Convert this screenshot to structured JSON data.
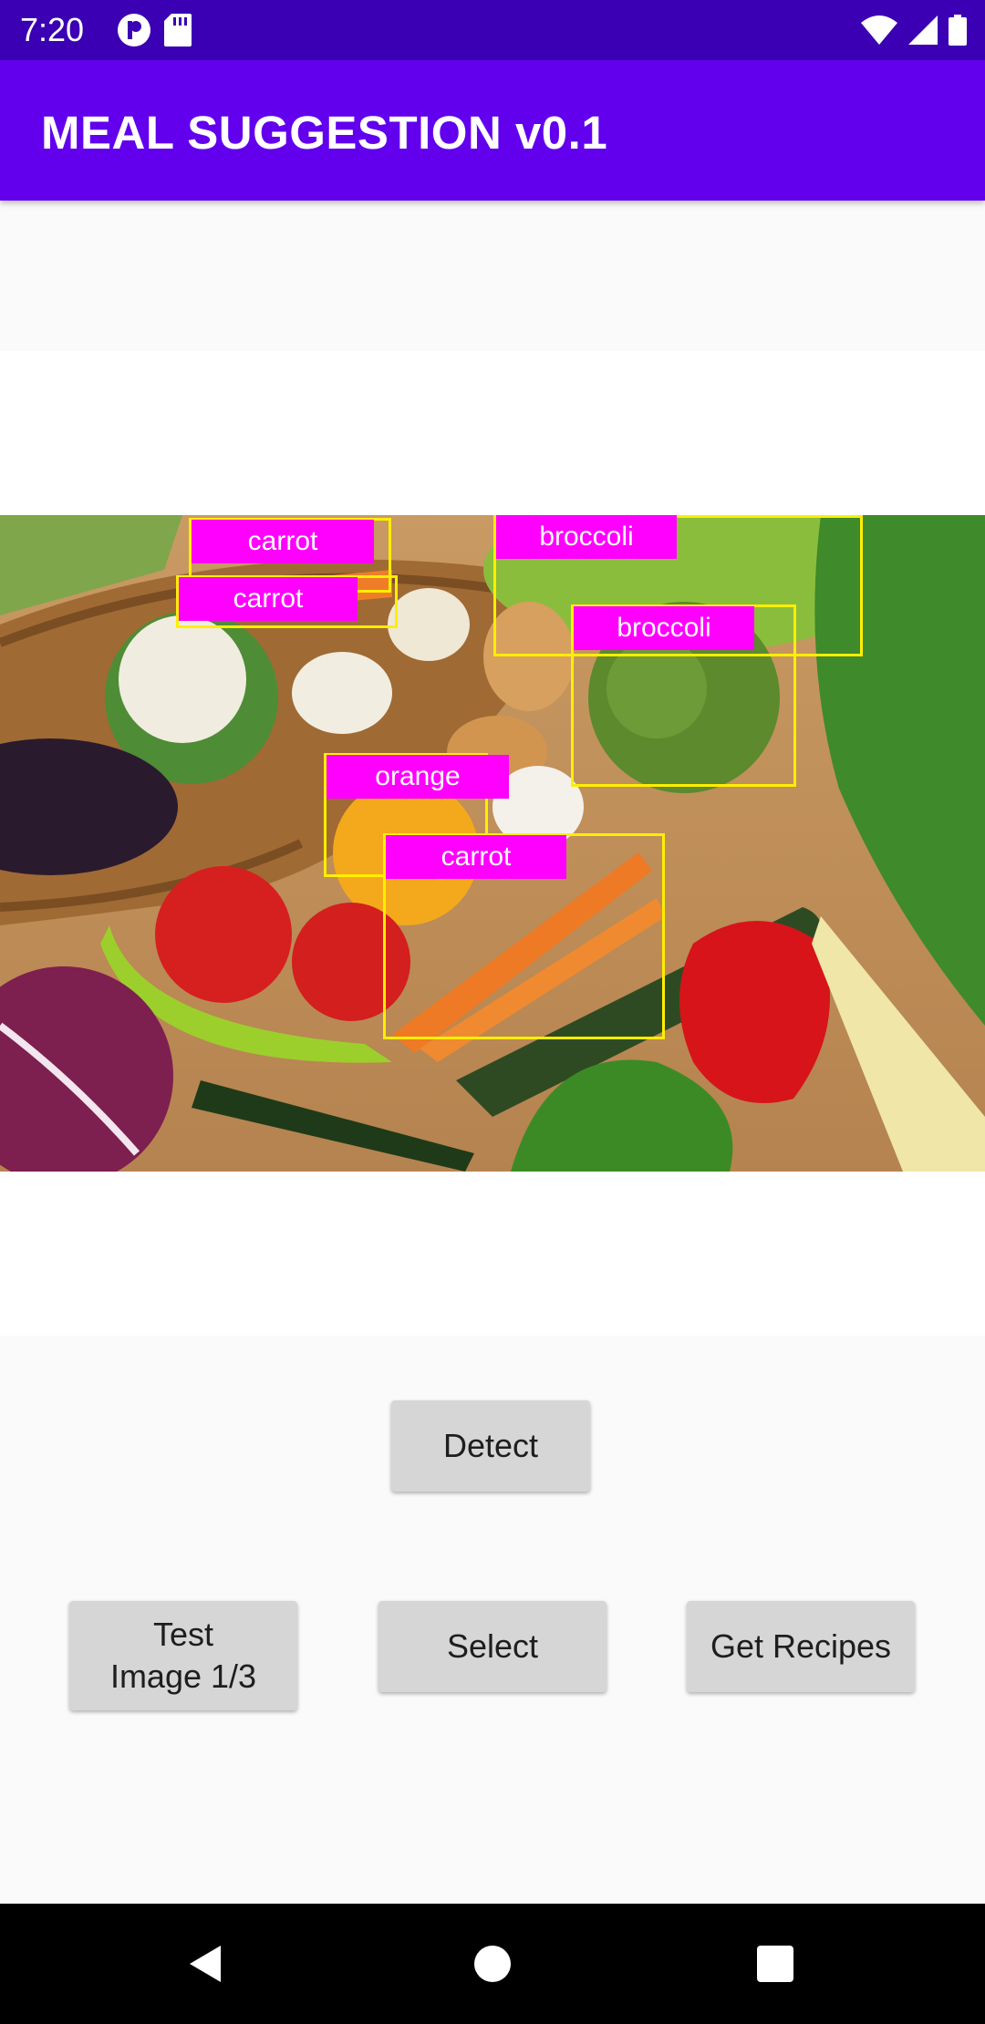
{
  "status_bar": {
    "time": "7:20",
    "left_icons": [
      "app-notification-icon",
      "sd-card-icon"
    ],
    "right_icons": [
      "wifi-icon",
      "cell-signal-icon",
      "battery-icon"
    ]
  },
  "app_bar": {
    "title": "MEAL SUGGESTION v0.1"
  },
  "detections": [
    {
      "label": "carrot"
    },
    {
      "label": "carrot"
    },
    {
      "label": "broccoli"
    },
    {
      "label": "broccoli"
    },
    {
      "label": "orange"
    },
    {
      "label": "carrot"
    }
  ],
  "buttons": {
    "detect": "Detect",
    "test_image": "Test Image 1/3",
    "select": "Select",
    "get_recipes": "Get Recipes"
  },
  "colors": {
    "status_bar": "#3b00b3",
    "app_bar": "#6200ee",
    "box_outline": "#ffee00",
    "label_bg": "#ff00ff"
  },
  "nav_bar": {
    "icons": [
      "back-icon",
      "home-icon",
      "recents-icon"
    ]
  }
}
